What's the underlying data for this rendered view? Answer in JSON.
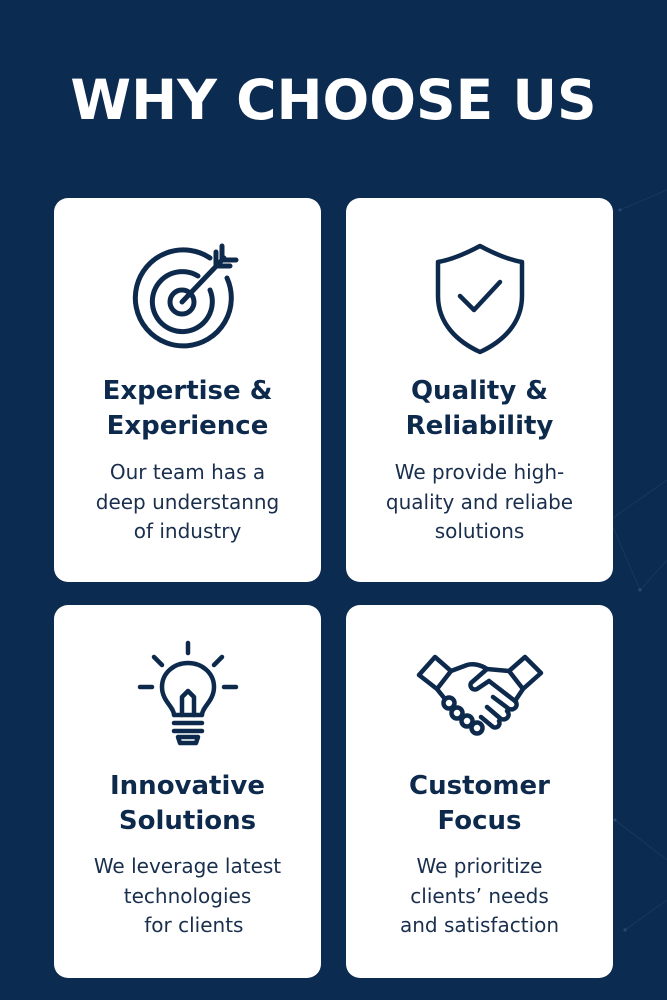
{
  "title": "WHY CHOOSE US",
  "colors": {
    "background": "#0c2b50",
    "card": "#ffffff",
    "text": "#0d2a4d"
  },
  "cards": [
    {
      "icon": "target-icon",
      "title_lines": [
        "Expertise &",
        "Experience"
      ],
      "desc_lines": [
        "Our team has a",
        "deep understanng",
        "of industry"
      ]
    },
    {
      "icon": "shield-check-icon",
      "title_lines": [
        "Quality &",
        "Reliability"
      ],
      "desc_lines": [
        "We provide high-",
        "quality and reliabe",
        "solutions"
      ]
    },
    {
      "icon": "lightbulb-icon",
      "title_lines": [
        "Innovative",
        "Solutions"
      ],
      "desc_lines": [
        "We leverage latest",
        "technologies",
        "  for clients"
      ]
    },
    {
      "icon": "handshake-icon",
      "title_lines": [
        "Customer",
        "Focus"
      ],
      "desc_lines": [
        "We prioritize",
        "clients’ needs",
        "and satisfaction"
      ]
    }
  ]
}
